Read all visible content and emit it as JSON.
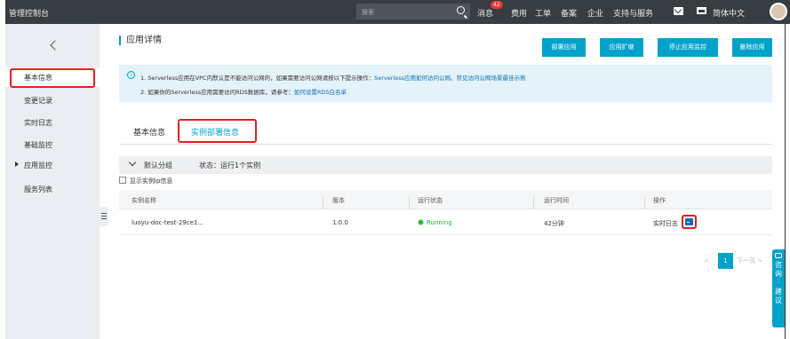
{
  "topbar": {
    "brand": "管理控制台",
    "search_placeholder": "搜索",
    "messages": "消息",
    "messages_badge": "42",
    "nav": [
      "费用",
      "工单",
      "备案",
      "企业",
      "支持与服务"
    ],
    "language": "简体中文"
  },
  "sidebar": {
    "items": [
      {
        "label": "基本信息"
      },
      {
        "label": "变更记录"
      },
      {
        "label": "实时日志"
      },
      {
        "label": "基础监控"
      },
      {
        "label": "应用监控"
      },
      {
        "label": "服务列表"
      }
    ]
  },
  "main": {
    "title": "应用详情",
    "buttons": [
      "部署应用",
      "应用扩缩",
      "停止应用监控",
      "删除应用"
    ],
    "notice": {
      "line1_text": "1. Serverless应用在VPC内默认是不能访问公网的，如果需要访问公网请按以下提示操作：",
      "line1_link1": "Serverless应用如何访问公网",
      "line1_sep": "、",
      "line1_link2": "常见访问公网场景最佳示例",
      "line2_text": "2. 如果你的Serverless应用需要访问RDS数据库，请参考：",
      "line2_link": "如何设置RDS白名单"
    },
    "tabs": [
      "基本信息",
      "实例部署信息"
    ],
    "group": {
      "name": "默认分组",
      "status": "状态：运行1个实例"
    },
    "show_ip_label": "显示实例ip信息",
    "table": {
      "headers": [
        "实例名称",
        "版本",
        "运行状态",
        "运行时间",
        "操作"
      ],
      "rows": [
        {
          "name": "luoyu-doc-test-29ce1...",
          "version": "1.0.0",
          "status": "Running",
          "runtime": "42分钟",
          "action": "实时日志"
        }
      ]
    },
    "pagination": {
      "prev": "<",
      "current": "1",
      "next": "下一页 >"
    },
    "consult": [
      "咨",
      "询",
      "·",
      "建",
      "议"
    ]
  },
  "colors": {
    "accent": "#00a2ca",
    "topbar": "#373d41",
    "sidebar": "#eaedf1",
    "highlight": "#e02020",
    "running": "#1bb934"
  }
}
